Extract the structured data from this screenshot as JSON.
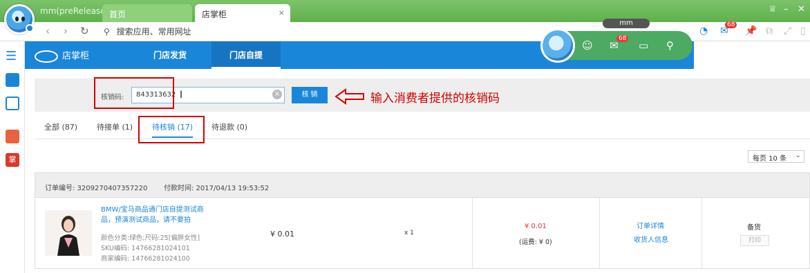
{
  "titlebar": {
    "app_title": "mm(preRelease)",
    "tabs": [
      {
        "label": "首页"
      },
      {
        "label": "店掌柜",
        "close": "×"
      }
    ],
    "mm_label": "mm"
  },
  "toolbar": {
    "address_placeholder": "搜索应用、常用网址",
    "mail_badge": "68"
  },
  "app_header": {
    "logo_text": "店掌柜",
    "nav": [
      {
        "label": "门店发货"
      },
      {
        "label": "门店自提"
      }
    ]
  },
  "widget": {
    "badge": "68"
  },
  "verify": {
    "label": "核销码:",
    "input_value": "843313632",
    "button_label": "核 销"
  },
  "annotation": {
    "text": "输入消费者提供的核销码",
    "color": "#d40000"
  },
  "filter_tabs": [
    {
      "label": "全部 (87)"
    },
    {
      "label": "待接单 (1)"
    },
    {
      "label": "待核销 (17)"
    },
    {
      "label": "待退款 (0)"
    }
  ],
  "page_size": "每页 10 条",
  "order": {
    "number": "订单编号: 3209270407357220",
    "paid_time": "付款时间: 2017/04/13 19:53:52",
    "product_title": "BMW/宝马商品通门店自提测试商品，预演测试商品，请不要拍",
    "attrs": "颜色分类:绿色;尺码:25[偏胖女性]",
    "sku": "SKU编码: 14766281024101",
    "merchant_code": "商家编码: 14766281024100",
    "unit_price": "¥ 0.01",
    "quantity": "x 1",
    "total": "¥ 0.01",
    "shipping": "(运费: ¥ 0)",
    "detail_link": "订单详情",
    "receiver_link": "收货人信息",
    "status": "备货",
    "print_label": "打印"
  },
  "colors": {
    "brand": "#1a86d9",
    "titlebar": "#5fb04d",
    "price": "#e33"
  }
}
